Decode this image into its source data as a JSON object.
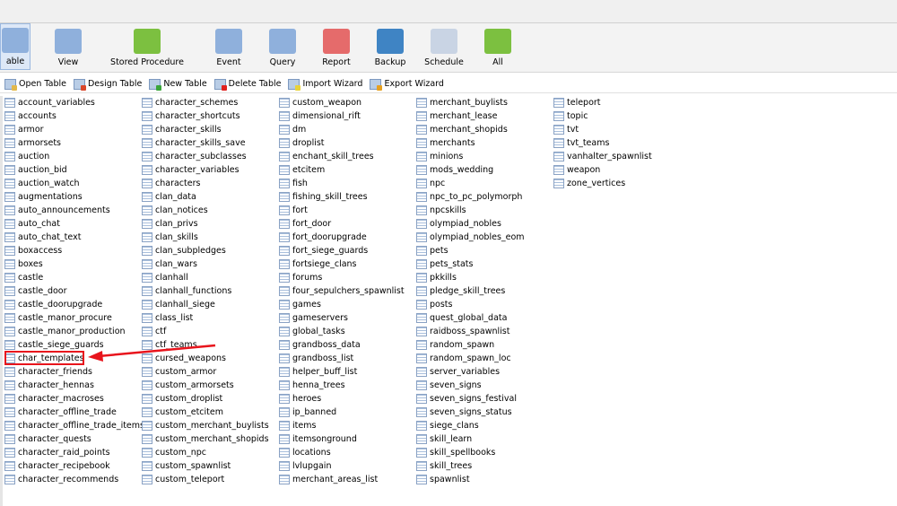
{
  "toolbar": {
    "buttons": [
      {
        "label": "able",
        "color": "#8fb0dc"
      },
      {
        "label": "View",
        "color": "#8fb0dc"
      },
      {
        "label": "Stored Procedure",
        "color": "#7cc040"
      },
      {
        "label": "Event",
        "color": "#8fb0dc"
      },
      {
        "label": "Query",
        "color": "#8fb0dc"
      },
      {
        "label": "Report",
        "color": "#e56b6b"
      },
      {
        "label": "Backup",
        "color": "#3f84c4"
      },
      {
        "label": "Schedule",
        "color": "#c9d4e4"
      },
      {
        "label": "All",
        "color": "#7cc040"
      }
    ]
  },
  "subtoolbar": {
    "buttons": [
      {
        "label": "Open Table",
        "badge": "#e2b84a"
      },
      {
        "label": "Design Table",
        "badge": "#d9472b"
      },
      {
        "label": "New Table",
        "badge": "#3aa53a"
      },
      {
        "label": "Delete Table",
        "badge": "#e0201e"
      },
      {
        "label": "Import Wizard",
        "badge": "#e8d23a"
      },
      {
        "label": "Export Wizard",
        "badge": "#e6a020"
      }
    ]
  },
  "tables": [
    [
      "account_variables",
      "accounts",
      "armor",
      "armorsets",
      "auction",
      "auction_bid",
      "auction_watch",
      "augmentations",
      "auto_announcements",
      "auto_chat",
      "auto_chat_text",
      "boxaccess",
      "boxes",
      "castle",
      "castle_door",
      "castle_doorupgrade",
      "castle_manor_procure",
      "castle_manor_production",
      "castle_siege_guards",
      "char_templates",
      "character_friends",
      "character_hennas",
      "character_macroses",
      "character_offline_trade",
      "character_offline_trade_items",
      "character_quests",
      "character_raid_points",
      "character_recipebook",
      "character_recommends"
    ],
    [
      "character_schemes",
      "character_shortcuts",
      "character_skills",
      "character_skills_save",
      "character_subclasses",
      "character_variables",
      "characters",
      "clan_data",
      "clan_notices",
      "clan_privs",
      "clan_skills",
      "clan_subpledges",
      "clan_wars",
      "clanhall",
      "clanhall_functions",
      "clanhall_siege",
      "class_list",
      "ctf",
      "ctf_teams",
      "cursed_weapons",
      "custom_armor",
      "custom_armorsets",
      "custom_droplist",
      "custom_etcitem",
      "custom_merchant_buylists",
      "custom_merchant_shopids",
      "custom_npc",
      "custom_spawnlist",
      "custom_teleport"
    ],
    [
      "custom_weapon",
      "dimensional_rift",
      "dm",
      "droplist",
      "enchant_skill_trees",
      "etcitem",
      "fish",
      "fishing_skill_trees",
      "fort",
      "fort_door",
      "fort_doorupgrade",
      "fort_siege_guards",
      "fortsiege_clans",
      "forums",
      "four_sepulchers_spawnlist",
      "games",
      "gameservers",
      "global_tasks",
      "grandboss_data",
      "grandboss_list",
      "helper_buff_list",
      "henna_trees",
      "heroes",
      "ip_banned",
      "items",
      "itemsonground",
      "locations",
      "lvlupgain",
      "merchant_areas_list"
    ],
    [
      "merchant_buylists",
      "merchant_lease",
      "merchant_shopids",
      "merchants",
      "minions",
      "mods_wedding",
      "npc",
      "npc_to_pc_polymorph",
      "npcskills",
      "olympiad_nobles",
      "olympiad_nobles_eom",
      "pets",
      "pets_stats",
      "pkkills",
      "pledge_skill_trees",
      "posts",
      "quest_global_data",
      "raidboss_spawnlist",
      "random_spawn",
      "random_spawn_loc",
      "server_variables",
      "seven_signs",
      "seven_signs_festival",
      "seven_signs_status",
      "siege_clans",
      "skill_learn",
      "skill_spellbooks",
      "skill_trees",
      "spawnlist"
    ],
    [
      "teleport",
      "topic",
      "tvt",
      "tvt_teams",
      "vanhalter_spawnlist",
      "weapon",
      "zone_vertices"
    ]
  ],
  "annotation": {
    "highlighted": "char_templates",
    "color": "#e8141c"
  }
}
